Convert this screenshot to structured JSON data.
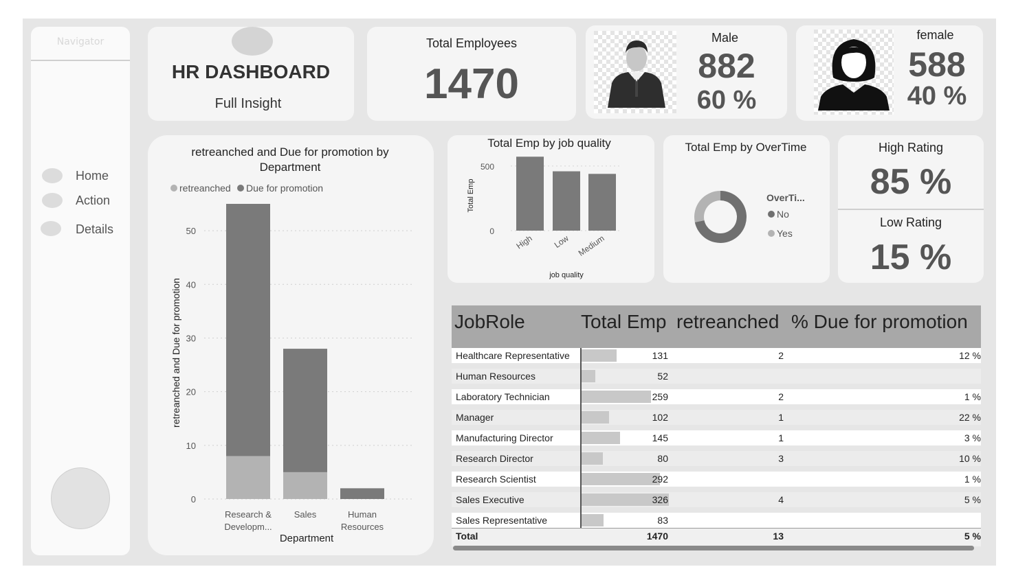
{
  "navigator": {
    "title": "Navigator",
    "items": [
      {
        "label": "Home"
      },
      {
        "label": "Action"
      },
      {
        "label": "Details"
      }
    ]
  },
  "header": {
    "title": "HR DASHBOARD",
    "subtitle": "Full Insight"
  },
  "kpis": {
    "total_employees": {
      "label": "Total Employees",
      "value": "1470"
    },
    "male": {
      "label": "Male",
      "value": "882",
      "percent": "60 %"
    },
    "female": {
      "label": "female",
      "value": "588",
      "percent": "40 %"
    },
    "high_rating": {
      "label": "High Rating",
      "value": "85 %"
    },
    "low_rating": {
      "label": "Low Rating",
      "value": "15 %"
    }
  },
  "colors": {
    "dark_series": "#7a7a7a",
    "light_series": "#b3b3b3",
    "card": "#f5f5f5",
    "canvas": "#e6e6e6"
  },
  "chart_data": [
    {
      "type": "bar",
      "stacked": true,
      "title": "retreanched and Due for promotion by Department",
      "xlabel": "Department",
      "ylabel": "retreanched and Due for promotion",
      "categories": [
        "Research & Developm...",
        "Sales",
        "Human Resources"
      ],
      "series": [
        {
          "name": "retreanched",
          "values": [
            8,
            5,
            0
          ]
        },
        {
          "name": "Due for promotion",
          "values": [
            47,
            23,
            2
          ]
        }
      ],
      "ylim": [
        0,
        55
      ],
      "yticks": [
        0,
        10,
        20,
        30,
        40,
        50
      ],
      "legend": "top",
      "grid": true
    },
    {
      "type": "bar",
      "title": "Total Emp by job quality",
      "xlabel": "job quality",
      "ylabel": "Total Emp",
      "categories": [
        "High",
        "Low",
        "Medium"
      ],
      "values": [
        572,
        459,
        439
      ],
      "ylim": [
        0,
        600
      ],
      "yticks": [
        0,
        500
      ]
    },
    {
      "type": "pie",
      "donut": true,
      "title": "Total Emp by OverTime",
      "legend_title": "OverTi...",
      "labels": [
        "No",
        "Yes"
      ],
      "values": [
        1054,
        416
      ],
      "colors": [
        "#707070",
        "#b3b3b3"
      ]
    },
    {
      "type": "table",
      "columns": [
        "JobRole",
        "Total Emp",
        "retreanched",
        "% Due for promotion"
      ],
      "rows": [
        {
          "role": "Healthcare Representative",
          "total": "131",
          "retr": "2",
          "due": "12 %"
        },
        {
          "role": "Human Resources",
          "total": "52",
          "retr": "",
          "due": ""
        },
        {
          "role": "Laboratory Technician",
          "total": "259",
          "retr": "2",
          "due": "1 %"
        },
        {
          "role": "Manager",
          "total": "102",
          "retr": "1",
          "due": "22 %"
        },
        {
          "role": "Manufacturing Director",
          "total": "145",
          "retr": "1",
          "due": "3 %"
        },
        {
          "role": "Research Director",
          "total": "80",
          "retr": "3",
          "due": "10 %"
        },
        {
          "role": "Research Scientist",
          "total": "292",
          "retr": "",
          "due": "1 %"
        },
        {
          "role": "Sales Executive",
          "total": "326",
          "retr": "4",
          "due": "5 %"
        },
        {
          "role": "Sales Representative",
          "total": "83",
          "retr": "",
          "due": ""
        }
      ],
      "total": {
        "label": "Total",
        "total": "1470",
        "retr": "13",
        "due": "5 %"
      },
      "max_total": 326
    }
  ]
}
